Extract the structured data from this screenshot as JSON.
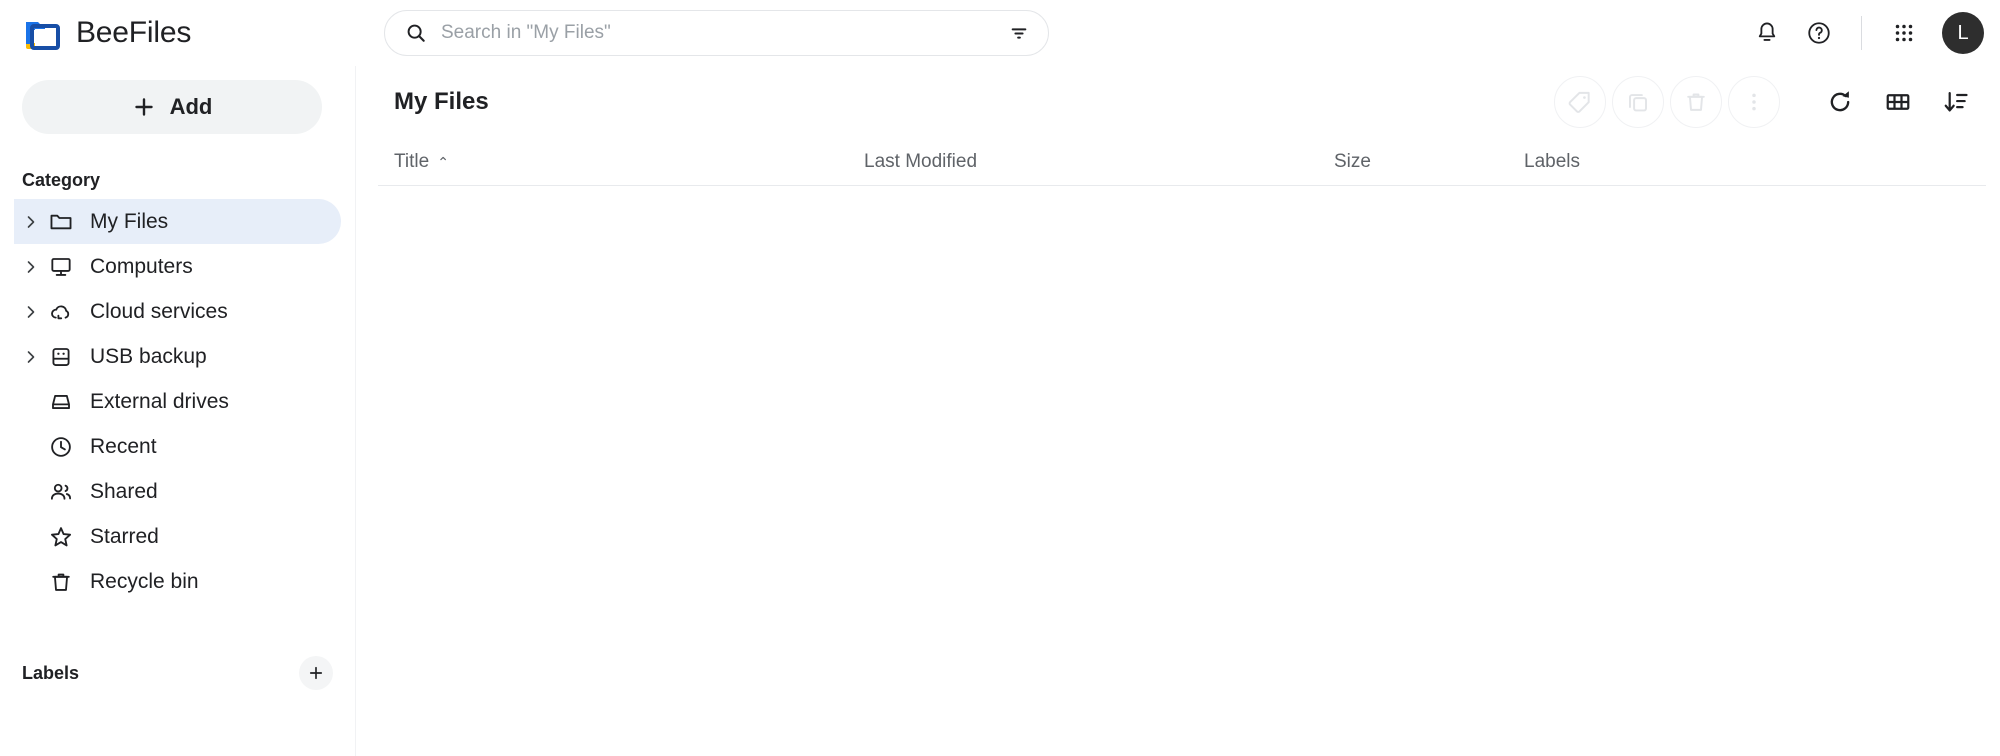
{
  "app": {
    "brand_name": "BeeFiles",
    "logo_icon": "folder-logo-icon",
    "accent_blue": "#1a73e8",
    "logo_blue": "#1a73e8",
    "logo_navy": "#174ea6",
    "logo_yellow": "#fbbc04",
    "selected_bg": "#e7eef9",
    "avatar_bg": "#2e2e2e",
    "muted_text": "#5f6368",
    "disabled_icon": "#e3e5e8"
  },
  "search": {
    "placeholder": "Search in \"My Files\"",
    "value": "",
    "search_icon": "search-icon",
    "filter_icon": "filter-icon"
  },
  "header_actions": {
    "notifications_icon": "bell-icon",
    "help_icon": "help-circle-icon",
    "apps_icon": "apps-grid-icon",
    "avatar_initial": "L"
  },
  "sidebar": {
    "add_button": {
      "label": "Add",
      "icon": "plus-icon"
    },
    "category_heading": "Category",
    "items": [
      {
        "label": "My Files",
        "icon": "folder-icon",
        "expandable": true,
        "selected": true
      },
      {
        "label": "Computers",
        "icon": "computer-icon",
        "expandable": true,
        "selected": false
      },
      {
        "label": "Cloud services",
        "icon": "cloud-sync-icon",
        "expandable": true,
        "selected": false
      },
      {
        "label": "USB backup",
        "icon": "usb-drive-icon",
        "expandable": true,
        "selected": false
      },
      {
        "label": "External drives",
        "icon": "hard-drive-icon",
        "expandable": false,
        "selected": false
      },
      {
        "label": "Recent",
        "icon": "clock-icon",
        "expandable": false,
        "selected": false
      },
      {
        "label": "Shared",
        "icon": "people-icon",
        "expandable": false,
        "selected": false
      },
      {
        "label": "Starred",
        "icon": "star-icon",
        "expandable": false,
        "selected": false
      },
      {
        "label": "Recycle bin",
        "icon": "trash-icon",
        "expandable": false,
        "selected": false
      }
    ],
    "labels_heading": "Labels",
    "add_label_icon": "plus-icon",
    "labels_items": []
  },
  "main": {
    "page_title": "My Files",
    "toolbar": [
      {
        "name": "tag-button",
        "icon": "tag-icon",
        "enabled": false
      },
      {
        "name": "copy-button",
        "icon": "copy-icon",
        "enabled": false
      },
      {
        "name": "delete-button",
        "icon": "trash-icon",
        "enabled": false
      },
      {
        "name": "more-button",
        "icon": "more-vert-icon",
        "enabled": false
      },
      {
        "name": "refresh-button",
        "icon": "refresh-icon",
        "enabled": true
      },
      {
        "name": "view-button",
        "icon": "grid-view-icon",
        "enabled": true
      },
      {
        "name": "sort-button",
        "icon": "sort-desc-icon",
        "enabled": true
      }
    ],
    "columns": [
      {
        "label": "Title",
        "sorted": true,
        "sort_caret": "⌃"
      },
      {
        "label": "Last Modified",
        "sorted": false,
        "sort_caret": ""
      },
      {
        "label": "Size",
        "sorted": false,
        "sort_caret": ""
      },
      {
        "label": "Labels",
        "sorted": false,
        "sort_caret": ""
      }
    ],
    "rows": []
  }
}
